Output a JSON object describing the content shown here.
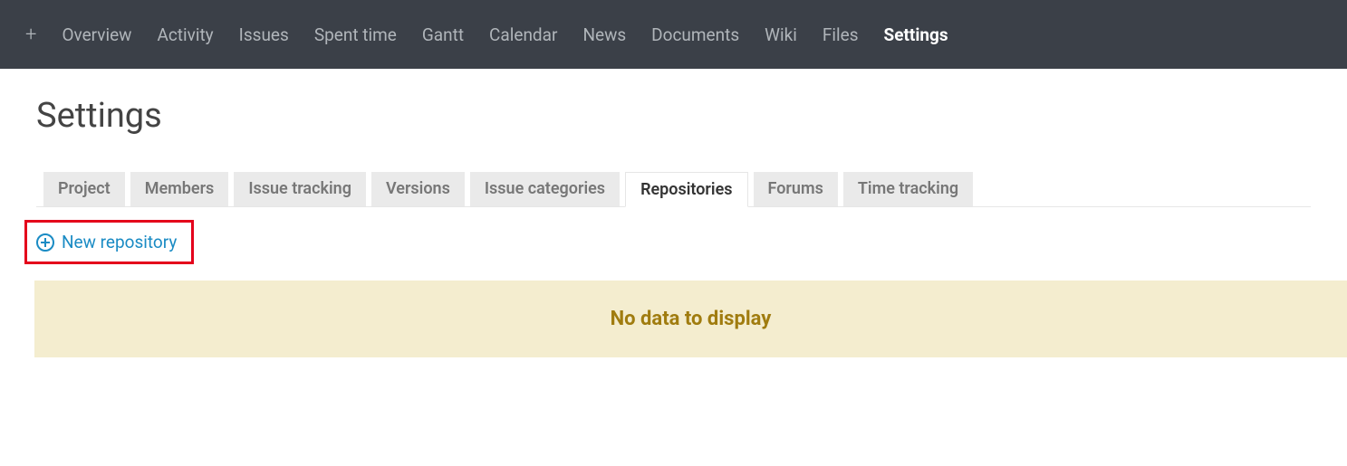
{
  "topnav": {
    "plus": "+",
    "items": [
      {
        "label": "Overview"
      },
      {
        "label": "Activity"
      },
      {
        "label": "Issues"
      },
      {
        "label": "Spent time"
      },
      {
        "label": "Gantt"
      },
      {
        "label": "Calendar"
      },
      {
        "label": "News"
      },
      {
        "label": "Documents"
      },
      {
        "label": "Wiki"
      },
      {
        "label": "Files"
      },
      {
        "label": "Settings",
        "active": true
      }
    ]
  },
  "page": {
    "title": "Settings"
  },
  "tabs": [
    {
      "label": "Project"
    },
    {
      "label": "Members"
    },
    {
      "label": "Issue tracking"
    },
    {
      "label": "Versions"
    },
    {
      "label": "Issue categories"
    },
    {
      "label": "Repositories",
      "active": true
    },
    {
      "label": "Forums"
    },
    {
      "label": "Time tracking"
    }
  ],
  "actions": {
    "new_repository": "New repository"
  },
  "empty": {
    "message": "No data to display"
  }
}
